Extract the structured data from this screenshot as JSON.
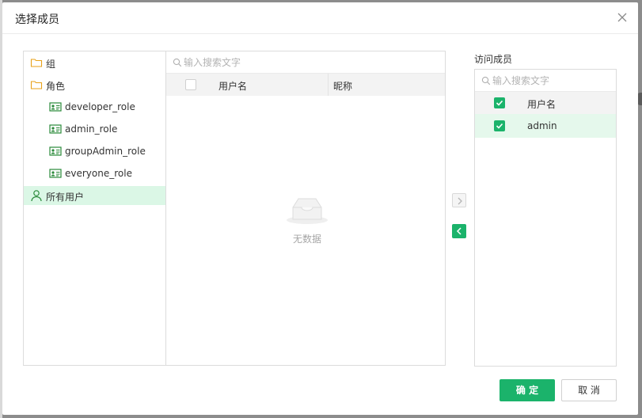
{
  "dialog": {
    "title": "选择成员",
    "ok_label": "确 定",
    "cancel_label": "取 消"
  },
  "tree": {
    "items": [
      {
        "label": "组",
        "icon": "folder-icon"
      },
      {
        "label": "角色",
        "icon": "folder-icon"
      },
      {
        "label": "developer_role",
        "icon": "role-card-icon"
      },
      {
        "label": "admin_role",
        "icon": "role-card-icon"
      },
      {
        "label": "groupAdmin_role",
        "icon": "role-card-icon"
      },
      {
        "label": "everyone_role",
        "icon": "role-card-icon"
      },
      {
        "label": "所有用户",
        "icon": "user-icon",
        "selected": true
      }
    ]
  },
  "user_list": {
    "search_placeholder": "输入搜索文字",
    "columns": [
      "用户名",
      "昵称"
    ],
    "rows": [],
    "empty_text": "无数据"
  },
  "members": {
    "label": "访问成员",
    "search_placeholder": "输入搜索文字",
    "column": "用户名",
    "rows": [
      {
        "username": "admin",
        "checked": true
      }
    ]
  },
  "colors": {
    "accent": "#1bb36b",
    "selected_row": "#dbf7e6",
    "header_bg": "#f3f3f3"
  }
}
